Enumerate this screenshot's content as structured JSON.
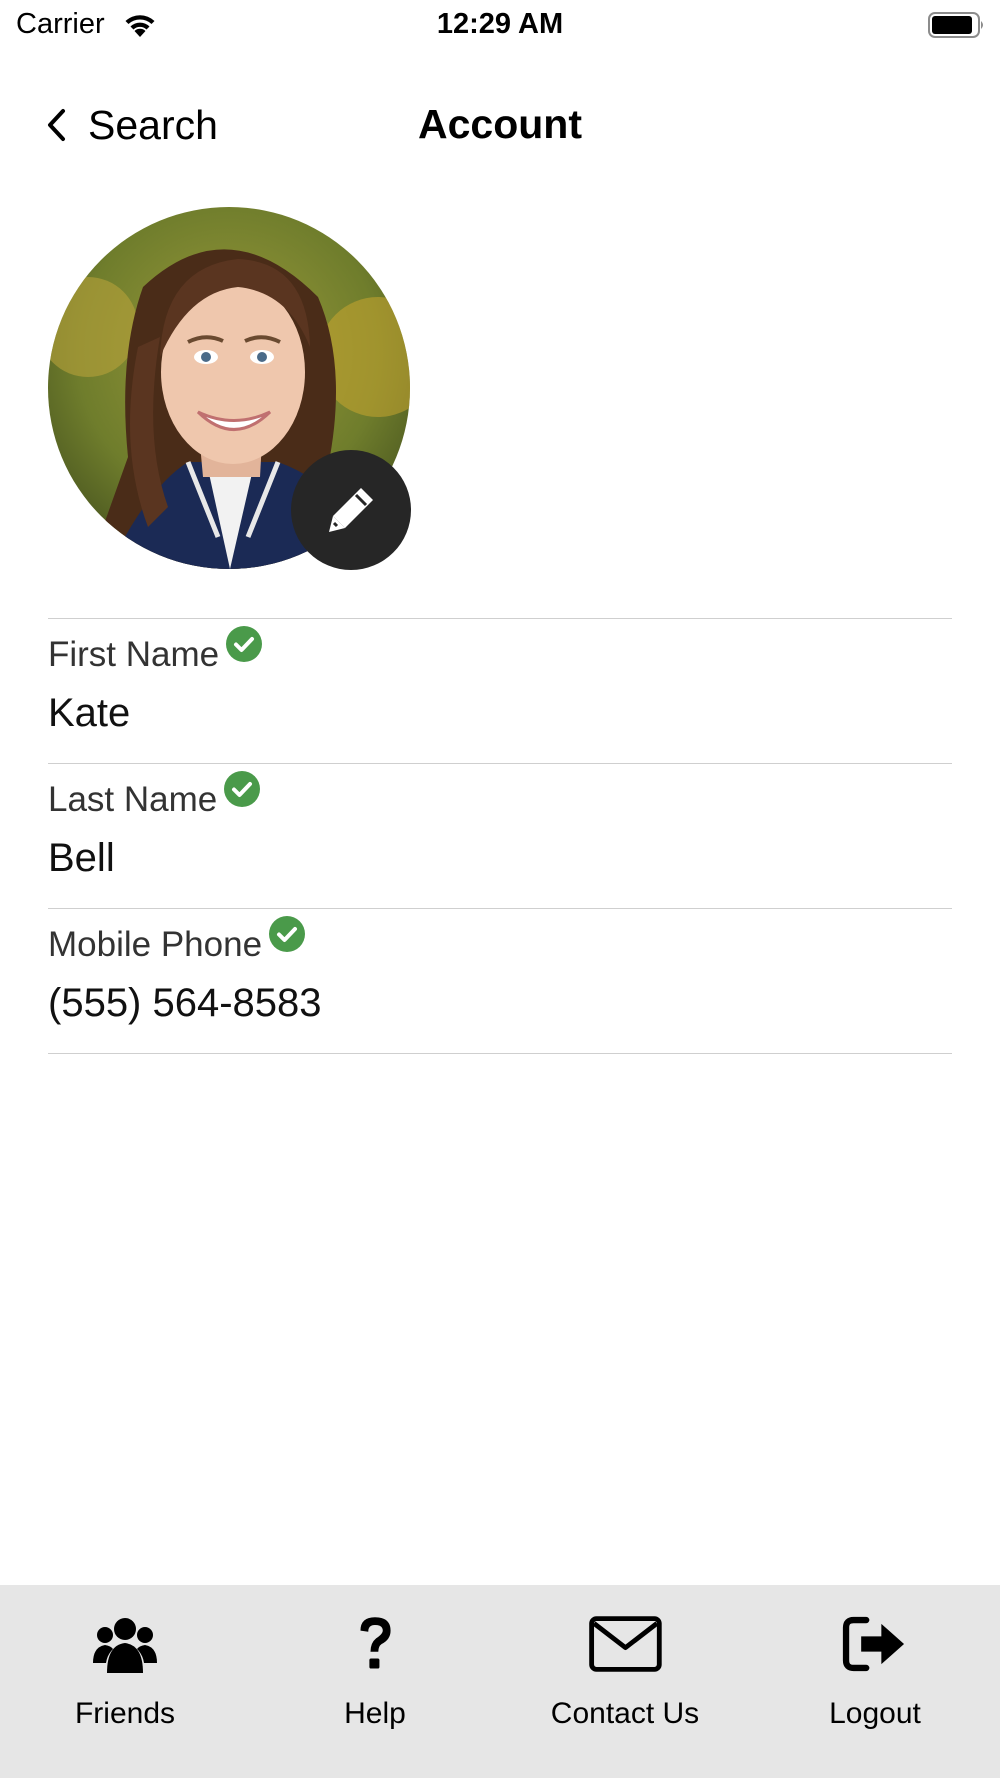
{
  "status_bar": {
    "carrier": "Carrier",
    "time": "12:29 AM",
    "icons": [
      "wifi-icon",
      "battery-icon"
    ]
  },
  "nav": {
    "back_label": "Search",
    "title": "Account"
  },
  "profile": {
    "edit_icon": "pencil-icon"
  },
  "fields": [
    {
      "label": "First Name",
      "value": "Kate",
      "verified": true
    },
    {
      "label": "Last Name",
      "value": "Bell",
      "verified": true
    },
    {
      "label": "Mobile Phone",
      "value": "(555) 564-8583",
      "verified": true
    }
  ],
  "tab_bar": {
    "items": [
      {
        "label": "Friends",
        "icon": "users-icon"
      },
      {
        "label": "Help",
        "icon": "question-icon"
      },
      {
        "label": "Contact Us",
        "icon": "envelope-icon"
      },
      {
        "label": "Logout",
        "icon": "sign-out-icon"
      }
    ]
  },
  "colors": {
    "verified_badge": "#4a9a4a",
    "edit_button": "#262626",
    "tab_bar_bg": "#e6e6e6",
    "divider": "#cfcfcf"
  }
}
